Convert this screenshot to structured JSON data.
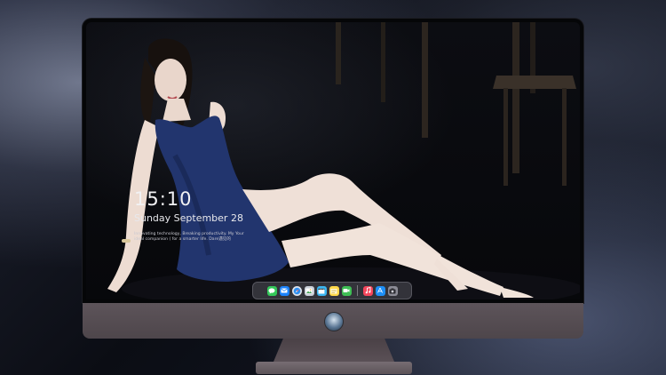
{
  "lockscreen": {
    "time": "15:10",
    "date": "Sunday September 28",
    "tagline": "Innovating technology, Breaking productivity. My Your ideal companion ( for a smarter life. Dare遇见的"
  },
  "dock": {
    "apps": [
      {
        "name": "messages",
        "icon": "chat-bubble",
        "color": "#33c759"
      },
      {
        "name": "mail",
        "icon": "envelope",
        "color": "#1a82fb"
      },
      {
        "name": "safari",
        "icon": "compass",
        "color": "#dde2ea"
      },
      {
        "name": "preview",
        "icon": "photo",
        "color": "#c9cfd8"
      },
      {
        "name": "clips",
        "icon": "clapper",
        "color": "#3bb5f0"
      },
      {
        "name": "notes",
        "icon": "notepad",
        "color": "#ffd84a"
      },
      {
        "name": "facetime",
        "icon": "camera",
        "color": "#3fbf55"
      },
      {
        "name": "music",
        "icon": "music-note",
        "color": "#f4465c"
      },
      {
        "name": "app-store",
        "icon": "app-store",
        "color": "#1d8ff7"
      },
      {
        "name": "screenshot",
        "icon": "camera-tool",
        "color": "#8c8c96"
      }
    ]
  },
  "colors": {
    "chin": "#5d545a",
    "dress": "#22356e",
    "accent_blue": "#1a82fb"
  }
}
